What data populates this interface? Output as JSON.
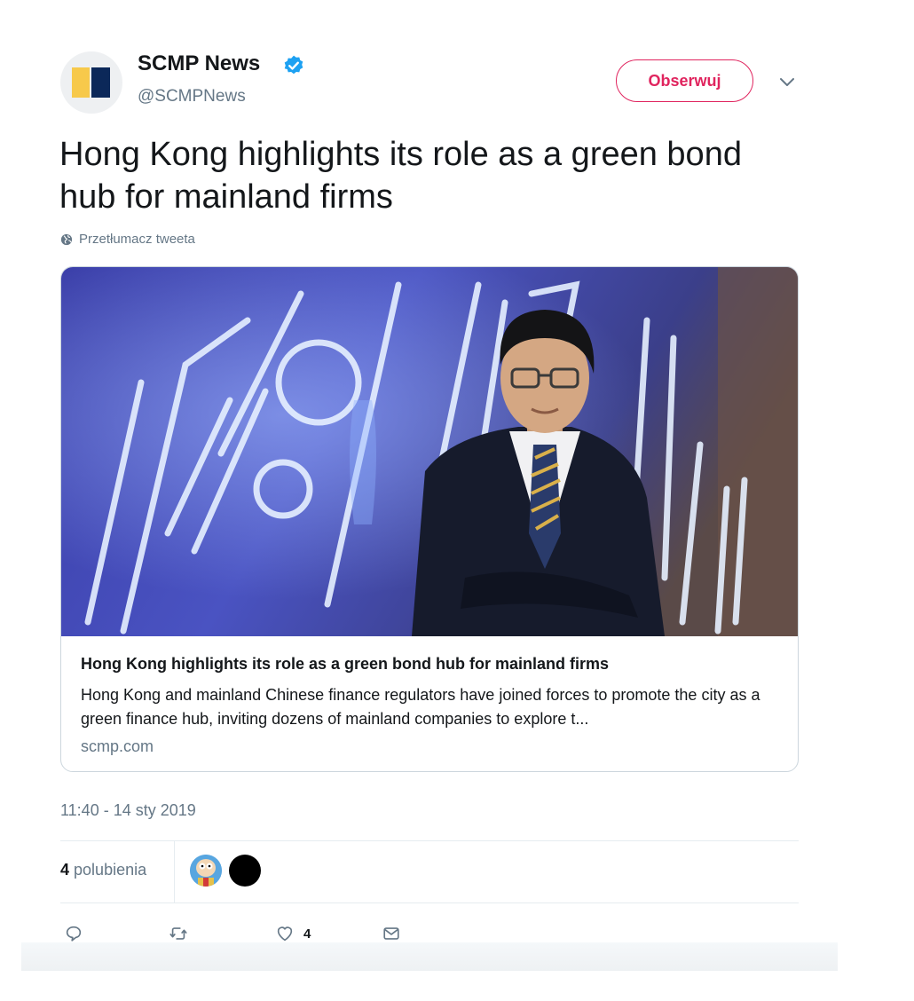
{
  "author": {
    "name": "SCMP News",
    "handle": "@SCMPNews",
    "follow_label": "Obserwuj"
  },
  "tweet": {
    "text": "Hong Kong highlights its role as a green bond hub for mainland firms",
    "translate_label": "Przetłumacz tweeta",
    "timestamp": "11:40 - 14 sty 2019"
  },
  "card": {
    "title": "Hong Kong highlights its role as a green bond hub for mainland firms",
    "description": "Hong Kong and mainland Chinese finance regulators have joined forces to promote the city as a green finance hub, inviting dozens of mainland companies to explore t...",
    "domain": "scmp.com"
  },
  "stats": {
    "likes_count": "4",
    "likes_label": "polubienia"
  },
  "actions": {
    "like_count": "4"
  },
  "icons": {
    "verified": "verified-badge-icon",
    "chevron": "chevron-down-icon",
    "globe": "globe-icon",
    "reply": "reply-icon",
    "retweet": "retweet-icon",
    "like": "heart-icon",
    "message": "direct-message-icon"
  },
  "colors": {
    "follow_accent": "#e0245e",
    "verified_blue": "#1da1f2",
    "secondary_text": "#657786"
  }
}
